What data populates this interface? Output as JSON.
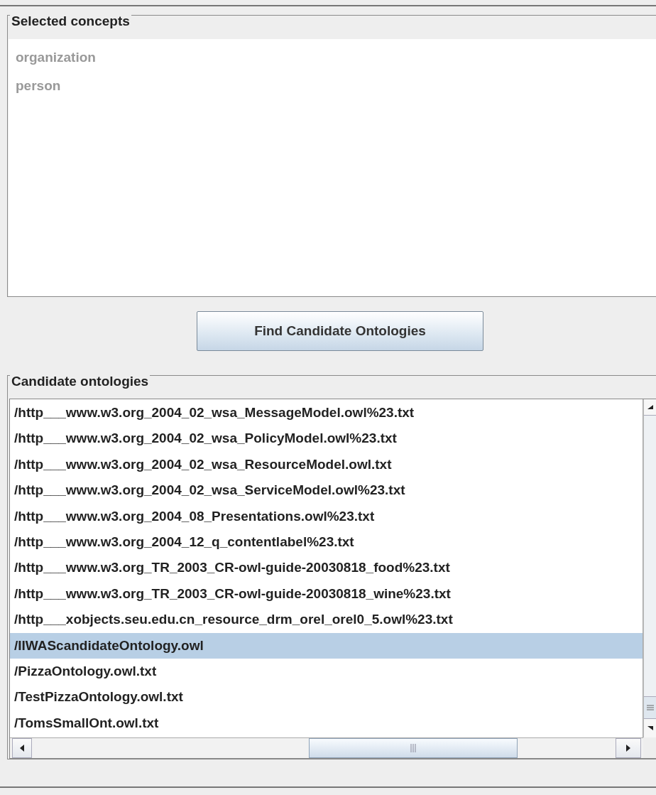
{
  "selected_concepts": {
    "title": "Selected concepts",
    "items": [
      {
        "label": "organization"
      },
      {
        "label": "person"
      }
    ]
  },
  "find_button": {
    "label": "Find Candidate Ontologies"
  },
  "candidate_ontologies": {
    "title": "Candidate ontologies",
    "items": [
      {
        "label": "/http___www.w3.org_2004_02_wsa_MessageModel.owl%23.txt",
        "selected": false
      },
      {
        "label": "/http___www.w3.org_2004_02_wsa_PolicyModel.owl%23.txt",
        "selected": false
      },
      {
        "label": "/http___www.w3.org_2004_02_wsa_ResourceModel.owl.txt",
        "selected": false
      },
      {
        "label": "/http___www.w3.org_2004_02_wsa_ServiceModel.owl%23.txt",
        "selected": false
      },
      {
        "label": "/http___www.w3.org_2004_08_Presentations.owl%23.txt",
        "selected": false
      },
      {
        "label": "/http___www.w3.org_2004_12_q_contentlabel%23.txt",
        "selected": false
      },
      {
        "label": "/http___www.w3.org_TR_2003_CR-owl-guide-20030818_food%23.txt",
        "selected": false
      },
      {
        "label": "/http___www.w3.org_TR_2003_CR-owl-guide-20030818_wine%23.txt",
        "selected": false
      },
      {
        "label": "/http___xobjects.seu.edu.cn_resource_drm_orel_orel0_5.owl%23.txt",
        "selected": false
      },
      {
        "label": "/IIWAScandidateOntology.owl",
        "selected": true
      },
      {
        "label": "/PizzaOntology.owl.txt",
        "selected": false
      },
      {
        "label": "/TestPizzaOntology.owl.txt",
        "selected": false
      },
      {
        "label": "/TomsSmallOnt.owl.txt",
        "selected": false
      }
    ]
  }
}
